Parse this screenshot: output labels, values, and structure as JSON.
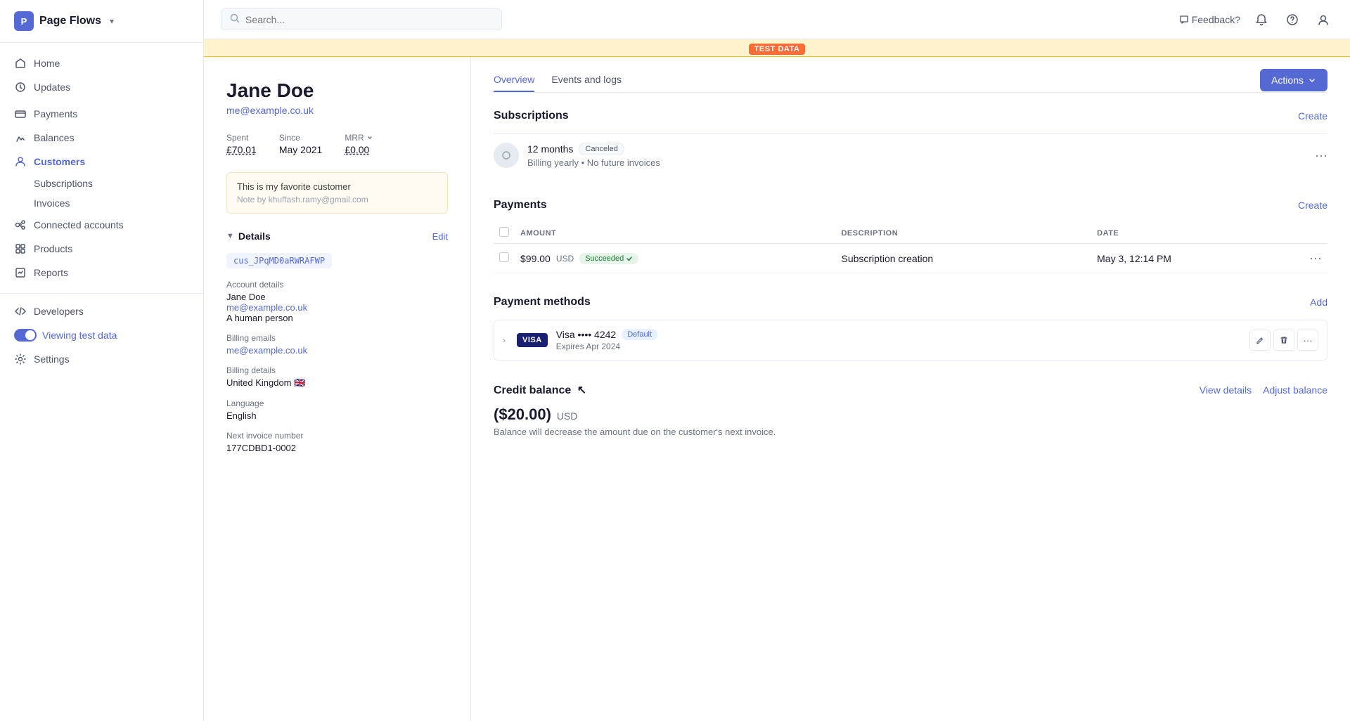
{
  "sidebar": {
    "logo": {
      "text": "Page Flows",
      "icon": "P"
    },
    "items": [
      {
        "id": "home",
        "label": "Home",
        "icon": "home"
      },
      {
        "id": "updates",
        "label": "Updates",
        "icon": "updates"
      },
      {
        "id": "payments",
        "label": "Payments",
        "icon": "payments"
      },
      {
        "id": "balances",
        "label": "Balances",
        "icon": "balances"
      },
      {
        "id": "customers",
        "label": "Customers",
        "icon": "customers",
        "active": true
      },
      {
        "id": "subscriptions",
        "label": "Subscriptions",
        "icon": "",
        "sub": true
      },
      {
        "id": "invoices",
        "label": "Invoices",
        "icon": "",
        "sub": true
      },
      {
        "id": "connected-accounts",
        "label": "Connected accounts",
        "icon": "connected"
      },
      {
        "id": "products",
        "label": "Products",
        "icon": "products"
      },
      {
        "id": "reports",
        "label": "Reports",
        "icon": "reports"
      },
      {
        "id": "developers",
        "label": "Developers",
        "icon": "developers"
      }
    ],
    "viewing_test": "Viewing test data",
    "settings": "Settings"
  },
  "topbar": {
    "search_placeholder": "Search...",
    "feedback": "Feedback?",
    "test_badge": "TEST DATA"
  },
  "customer": {
    "name": "Jane Doe",
    "email": "me@example.co.uk",
    "stats": {
      "spent_label": "Spent",
      "spent_value": "£70.01",
      "since_label": "Since",
      "since_value": "May 2021",
      "mrr_label": "MRR",
      "mrr_value": "£0.00"
    },
    "note": {
      "text": "This is my favorite customer",
      "author": "Note by khuffash.ramy@gmail.com"
    },
    "details": {
      "section_title": "Details",
      "edit_label": "Edit",
      "id": "cus_JPqMD0aRWRAFWP",
      "account_label": "Account details",
      "account_name": "Jane Doe",
      "account_email": "me@example.co.uk",
      "account_desc": "A human person",
      "billing_emails_label": "Billing emails",
      "billing_email": "me@example.co.uk",
      "billing_details_label": "Billing details",
      "billing_country": "United Kingdom 🇬🇧",
      "language_label": "Language",
      "language": "English",
      "next_invoice_label": "Next invoice number",
      "next_invoice": "177CDBD1-0002"
    }
  },
  "right_panel": {
    "tabs": [
      {
        "id": "overview",
        "label": "Overview",
        "active": true
      },
      {
        "id": "events-logs",
        "label": "Events and logs",
        "active": false
      }
    ],
    "actions_label": "Actions",
    "subscriptions": {
      "title": "Subscriptions",
      "create_label": "Create",
      "items": [
        {
          "name": "12 months",
          "status": "Canceled",
          "billing": "Billing yearly",
          "invoices": "No future invoices"
        }
      ]
    },
    "payments": {
      "title": "Payments",
      "create_label": "Create",
      "columns": [
        "AMOUNT",
        "DESCRIPTION",
        "DATE"
      ],
      "rows": [
        {
          "amount": "$99.00",
          "currency": "USD",
          "status": "Succeeded",
          "description": "Subscription creation",
          "date": "May 3, 12:14 PM"
        }
      ]
    },
    "payment_methods": {
      "title": "Payment methods",
      "add_label": "Add",
      "items": [
        {
          "brand": "VISA",
          "last4": "4242",
          "is_default": true,
          "default_label": "Default",
          "display": "Visa •••• 4242",
          "expires": "Expires Apr 2024"
        }
      ]
    },
    "credit_balance": {
      "title": "Credit balance",
      "view_details": "View details",
      "adjust_balance": "Adjust balance",
      "amount": "($20.00)",
      "currency": "USD",
      "note": "Balance will decrease the amount due on the customer's next invoice."
    }
  }
}
